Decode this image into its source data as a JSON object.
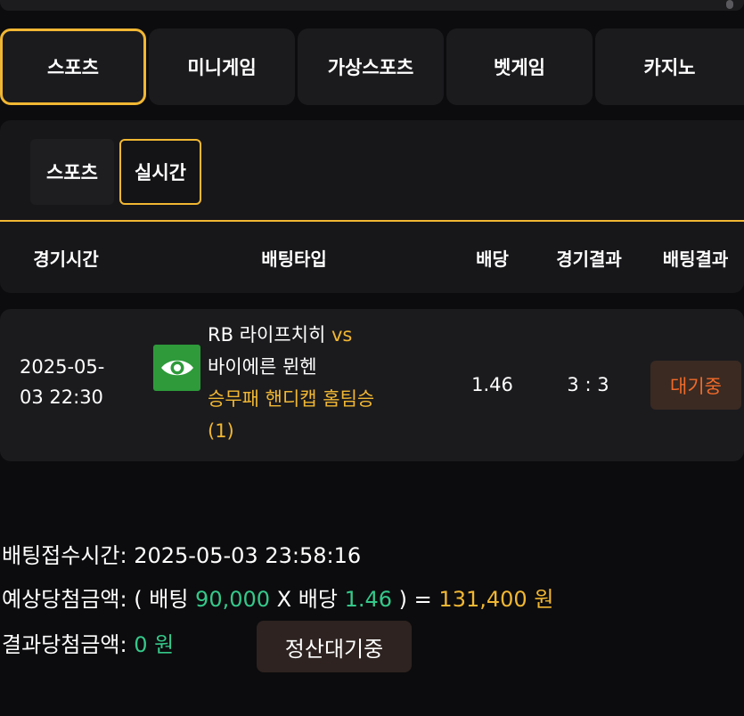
{
  "tabs": [
    {
      "label": "스포츠",
      "active": true
    },
    {
      "label": "미니게임",
      "active": false
    },
    {
      "label": "가상스포츠",
      "active": false
    },
    {
      "label": "벳게임",
      "active": false
    },
    {
      "label": "카지노",
      "active": false
    }
  ],
  "sub_tabs": [
    {
      "label": "스포츠",
      "active": false
    },
    {
      "label": "실시간",
      "active": true
    }
  ],
  "table": {
    "headers": {
      "time": "경기시간",
      "bet_type": "배팅타입",
      "odds": "배당",
      "game_result": "경기결과",
      "bet_result": "배팅결과"
    },
    "row": {
      "date": "2025-05-",
      "time": "03 22:30",
      "icon": "eye-icon",
      "home": "RB 라이프치히",
      "vs": "vs",
      "away": "바이에른 뮌헨",
      "market": "승무패 핸디캡 홈팀승",
      "selection": "(1)",
      "odds": "1.46",
      "score": "3 : 3",
      "status": "대기중"
    }
  },
  "summary": {
    "received_label": "배팅접수시간:",
    "received_value": "2025-05-03 23:58:16",
    "expected_label": "예상당첨금액:",
    "open_paren": "(",
    "bet_label": "배팅",
    "bet_amount": "90,000",
    "times": "X",
    "odds_label": "배당",
    "odds_value": "1.46",
    "close_paren": ")",
    "equals": "=",
    "expected_amount": "131,400",
    "currency": "원",
    "result_label": "결과당첨금액:",
    "result_amount": "0",
    "result_currency": "원",
    "settle_button": "정산대기중"
  },
  "colors": {
    "accent": "#f1b733",
    "green": "#35c88a",
    "status_orange": "#f06a2a",
    "icon_green": "#2e9a3a"
  }
}
